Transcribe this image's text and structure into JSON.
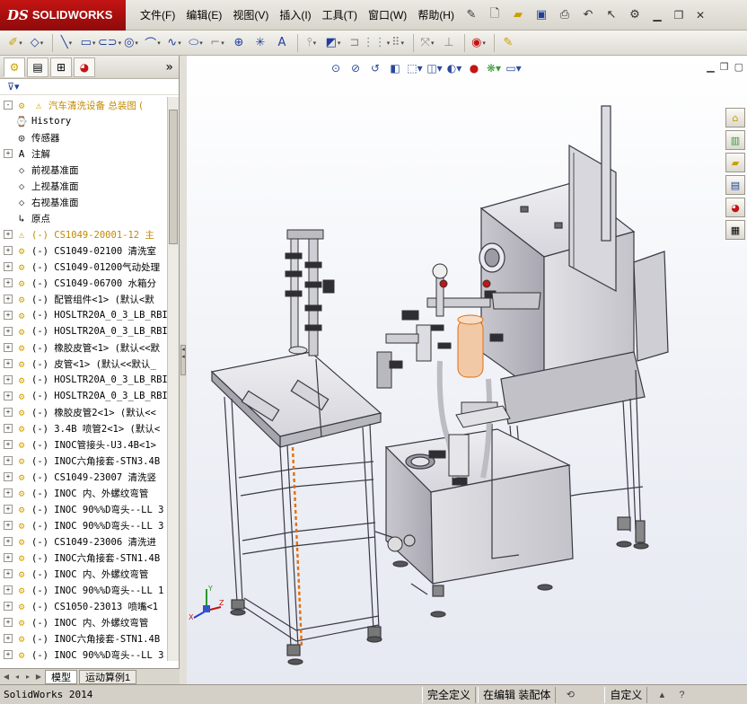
{
  "app": {
    "brand_prefix": "DS",
    "brand_name": "SOLIDWORKS"
  },
  "menu": [
    "文件(F)",
    "编辑(E)",
    "视图(V)",
    "插入(I)",
    "工具(T)",
    "窗口(W)",
    "帮助(H)"
  ],
  "feature_manager": {
    "filter_icon": "filter-icon",
    "rows": [
      {
        "expand": "-",
        "icon": "assembly",
        "warn": true,
        "text": "汽车清洗设备  总装图  (",
        "style": "root"
      },
      {
        "expand": "",
        "icon": "history",
        "text": "History"
      },
      {
        "expand": "",
        "icon": "sensor",
        "text": "传感器"
      },
      {
        "expand": "+",
        "icon": "annotation",
        "text": "注解"
      },
      {
        "expand": "",
        "icon": "plane",
        "text": "前视基准面"
      },
      {
        "expand": "",
        "icon": "plane",
        "text": "上视基准面"
      },
      {
        "expand": "",
        "icon": "plane",
        "text": "右视基准面"
      },
      {
        "expand": "",
        "icon": "origin",
        "text": "原点"
      },
      {
        "expand": "+",
        "icon": "assembly-warn",
        "text": "(-) CS1049-20001-12 主",
        "style": "yellow"
      },
      {
        "expand": "+",
        "icon": "assembly",
        "text": "(-) CS1049-02100 清洗室"
      },
      {
        "expand": "+",
        "icon": "assembly",
        "text": "(-) CS1049-01200气动处理"
      },
      {
        "expand": "+",
        "icon": "assembly",
        "text": "(-) CS1049-06700 水箱分"
      },
      {
        "expand": "+",
        "icon": "assembly",
        "text": "(-) 配管组件<1> (默认<默"
      },
      {
        "expand": "+",
        "icon": "assembly",
        "text": "(-) HOSLTR20A_0_3_LB_RBI"
      },
      {
        "expand": "+",
        "icon": "assembly",
        "text": "(-) HOSLTR20A_0_3_LB_RBI"
      },
      {
        "expand": "+",
        "icon": "assembly",
        "text": "(-) 橡胶皮管<1> (默认<<默"
      },
      {
        "expand": "+",
        "icon": "assembly",
        "text": "(-) 皮管<1> (默认<<默认_"
      },
      {
        "expand": "+",
        "icon": "assembly",
        "text": "(-) HOSLTR20A_0_3_LB_RBI"
      },
      {
        "expand": "+",
        "icon": "assembly",
        "text": "(-) HOSLTR20A_0_3_LB_RBI"
      },
      {
        "expand": "+",
        "icon": "assembly",
        "text": "(-) 橡胶皮管2<1> (默认<<"
      },
      {
        "expand": "+",
        "icon": "assembly",
        "text": "(-) 3.4B 喷管2<1> (默认<"
      },
      {
        "expand": "+",
        "icon": "assembly",
        "text": "(-) INOC管接头-U3.4B<1>"
      },
      {
        "expand": "+",
        "icon": "assembly",
        "text": "(-) INOC六角接套-STN3.4B"
      },
      {
        "expand": "+",
        "icon": "assembly",
        "text": "(-) CS1049-23007 清洗竖"
      },
      {
        "expand": "+",
        "icon": "assembly",
        "text": "(-) INOC 内、外螺纹弯管"
      },
      {
        "expand": "+",
        "icon": "assembly",
        "text": "(-) INOC 90%%D弯头--LL 3"
      },
      {
        "expand": "+",
        "icon": "assembly",
        "text": "(-) INOC 90%%D弯头--LL 3"
      },
      {
        "expand": "+",
        "icon": "assembly",
        "text": "(-) CS1049-23006 清洗进"
      },
      {
        "expand": "+",
        "icon": "assembly",
        "text": "(-) INOC六角接套-STN1.4B"
      },
      {
        "expand": "+",
        "icon": "assembly",
        "text": "(-) INOC 内、外螺纹弯管"
      },
      {
        "expand": "+",
        "icon": "assembly",
        "text": "(-) INOC 90%%D弯头--LL 1"
      },
      {
        "expand": "+",
        "icon": "assembly",
        "text": "(-) CS1050-23013 喷嘴<1"
      },
      {
        "expand": "+",
        "icon": "assembly",
        "text": "(-) INOC 内、外螺纹弯管"
      },
      {
        "expand": "+",
        "icon": "assembly",
        "text": "(-) INOC六角接套-STN1.4B"
      },
      {
        "expand": "+",
        "icon": "assembly",
        "text": "(-) INOC 90%%D弯头--LL 3"
      }
    ],
    "bottom_tabs": [
      "模型",
      "运动算例1"
    ]
  },
  "statusbar": {
    "app_version": "SolidWorks 2014",
    "cells": [
      "完全定义",
      "在编辑 装配体",
      "自定义"
    ]
  },
  "colors": {
    "brand_red": "#c41414",
    "graphics_bg": "#eef0f6",
    "model_grey": "#c8c6cc",
    "accent_orange": "#e07010",
    "highlight_yellow": "#c28a00"
  }
}
